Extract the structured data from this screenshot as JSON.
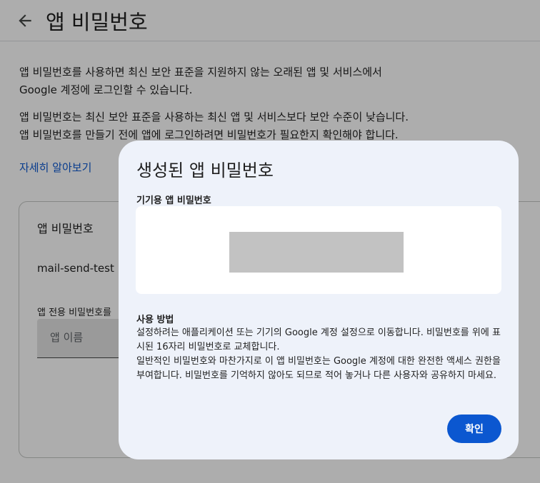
{
  "header": {
    "title": "앱 비밀번호"
  },
  "intro": {
    "paragraph1": "앱 비밀번호를 사용하면 최신 보안 표준을 지원하지 않는 오래된 앱 및 서비스에서 Google 계정에 로그인할 수 있습니다.",
    "paragraph2": "앱 비밀번호는 최신 보안 표준을 사용하는 최신 앱 및 서비스보다 보안 수준이 낮습니다. 앱 비밀번호를 만들기 전에 앱에 로그인하려면 비밀번호가 필요한지 확인해야 합니다.",
    "learn_more": "자세히 알아보기"
  },
  "card": {
    "title": "앱 비밀번호",
    "item": "mail-send-test",
    "create_label": "앱 전용 비밀번호를",
    "input_placeholder": "앱 이름"
  },
  "dialog": {
    "title": "생성된 앱 비밀번호",
    "device_label": "기기용 앱 비밀번호",
    "howto_title": "사용 방법",
    "howto_line1": "설정하려는 애플리케이션 또는 기기의 Google 계정 설정으로 이동합니다. 비밀번호를 위에 표시된 16자리 비밀번호로 교체합니다.",
    "howto_line2": "일반적인 비밀번호와 마찬가지로 이 앱 비밀번호는 Google 계정에 대한 완전한 액세스 권한을 부여합니다. 비밀번호를 기억하지 않아도 되므로 적어 놓거나 다른 사용자와 공유하지 마세요.",
    "ok_label": "확인"
  },
  "colors": {
    "accent": "#0b57d0",
    "dialog_bg": "#eef2fa",
    "scrim": "rgba(0,0,0,0.32)"
  }
}
